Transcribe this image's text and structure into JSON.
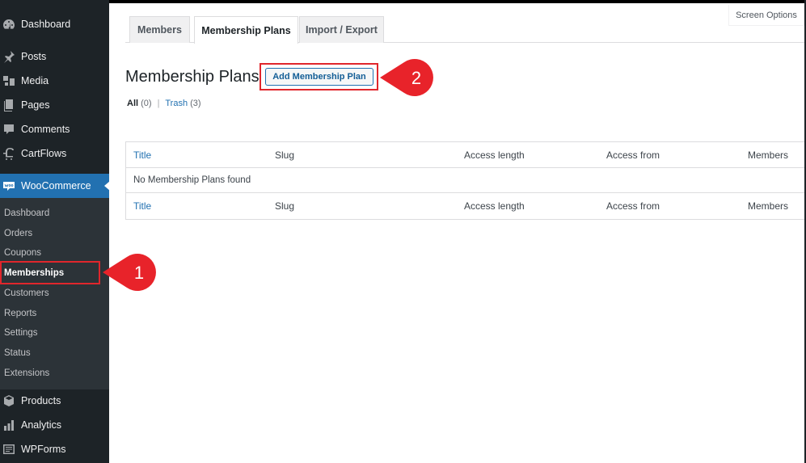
{
  "sidebar": {
    "items": [
      {
        "label": "Dashboard",
        "icon": "dashboard-icon"
      },
      {
        "label": "Posts",
        "icon": "pin-icon"
      },
      {
        "label": "Media",
        "icon": "media-icon"
      },
      {
        "label": "Pages",
        "icon": "pages-icon"
      },
      {
        "label": "Comments",
        "icon": "comment-icon"
      },
      {
        "label": "CartFlows",
        "icon": "cartflows-icon"
      },
      {
        "label": "WooCommerce",
        "icon": "woo-icon",
        "active": true
      },
      {
        "label": "Products",
        "icon": "box-icon"
      },
      {
        "label": "Analytics",
        "icon": "bar-chart-icon"
      },
      {
        "label": "WPForms",
        "icon": "form-icon"
      }
    ],
    "submenu": [
      {
        "label": "Dashboard"
      },
      {
        "label": "Orders"
      },
      {
        "label": "Coupons"
      },
      {
        "label": "Memberships",
        "current": true
      },
      {
        "label": "Customers"
      },
      {
        "label": "Reports"
      },
      {
        "label": "Settings"
      },
      {
        "label": "Status"
      },
      {
        "label": "Extensions"
      }
    ]
  },
  "header": {
    "screen_options": "Screen Options"
  },
  "tabs": [
    {
      "label": "Members"
    },
    {
      "label": "Membership Plans",
      "active": true
    },
    {
      "label": "Import / Export"
    }
  ],
  "page": {
    "title": "Membership Plans",
    "add_button": "Add Membership Plan",
    "filters": {
      "all_label": "All",
      "all_count": "(0)",
      "separator": "|",
      "trash_label": "Trash",
      "trash_count": "(3)"
    }
  },
  "table": {
    "columns": [
      "Title",
      "Slug",
      "Access length",
      "Access from",
      "Members"
    ],
    "empty_message": "No Membership Plans found"
  },
  "callouts": [
    {
      "number": "1",
      "color": "#e8232a"
    },
    {
      "number": "2",
      "color": "#e8232a"
    }
  ],
  "colors": {
    "sidebar_bg": "#1d2327",
    "submenu_bg": "#2c3338",
    "accent": "#2271b1",
    "highlight": "#e0262c"
  }
}
